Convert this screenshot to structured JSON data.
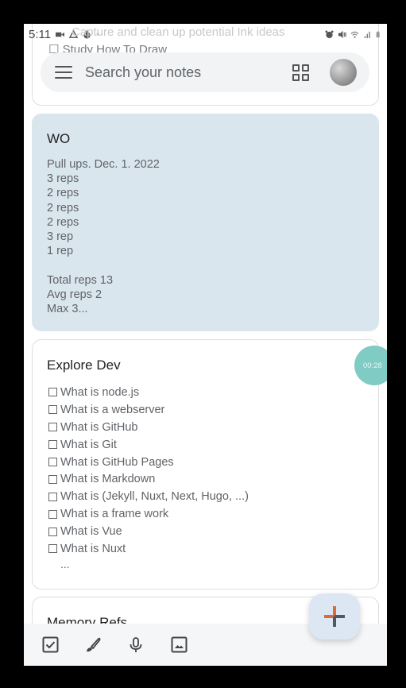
{
  "status_bar": {
    "time": "5:11",
    "ghost_text": "Capture and clean up potential Ink ideas",
    "left_icons": [
      "video-camera-icon",
      "drive-icon",
      "timer-icon",
      "dot-icon"
    ],
    "right_icons": [
      "alarm-icon",
      "mute-icon",
      "wifi-icon",
      "signal-icon",
      "battery-icon"
    ]
  },
  "search": {
    "placeholder": "Search your notes",
    "menu_icon": "hamburger-menu-icon",
    "layout_icon": "grid-view-icon",
    "avatar": "profile-avatar"
  },
  "notes": [
    {
      "id": "top-partial",
      "lines": [
        "☐ Study How To Draw"
      ]
    },
    {
      "id": "wo",
      "title": "WO",
      "color": "#dae6ee",
      "body": "Pull ups. Dec. 1. 2022\n3 reps\n2 reps\n2 reps\n2 reps\n3 rep\n1 rep\n\nTotal reps 13\nAvg reps 2\nMax 3..."
    },
    {
      "id": "explore-dev",
      "title": "Explore Dev",
      "checklist": [
        "What is node.js",
        "What is a webserver",
        "What is GitHub",
        "What is Git",
        "What is GitHub Pages",
        "What is Markdown",
        "What is (Jekyll, Nuxt, Next, Hugo, ...)",
        "What is a frame work",
        "What is Vue",
        "What is Nuxt"
      ],
      "more": "..."
    },
    {
      "id": "memory-refs",
      "title": "Memory Refs"
    }
  ],
  "timer_bubble": {
    "text": "00:28"
  },
  "bottom_bar": {
    "items": [
      {
        "icon": "checkbox-icon",
        "label": "New list"
      },
      {
        "icon": "brush-icon",
        "label": "New drawing"
      },
      {
        "icon": "microphone-icon",
        "label": "New audio note"
      },
      {
        "icon": "image-icon",
        "label": "New image note"
      }
    ]
  },
  "fab": {
    "icon": "plus-icon",
    "label": "New note"
  },
  "colors": {
    "wo_note": "#dae6ee",
    "fab_bg": "#dde6f3",
    "timer": "#80cbc4",
    "plus_orange": "#e0693a",
    "plus_dark": "#4f5a5e"
  }
}
